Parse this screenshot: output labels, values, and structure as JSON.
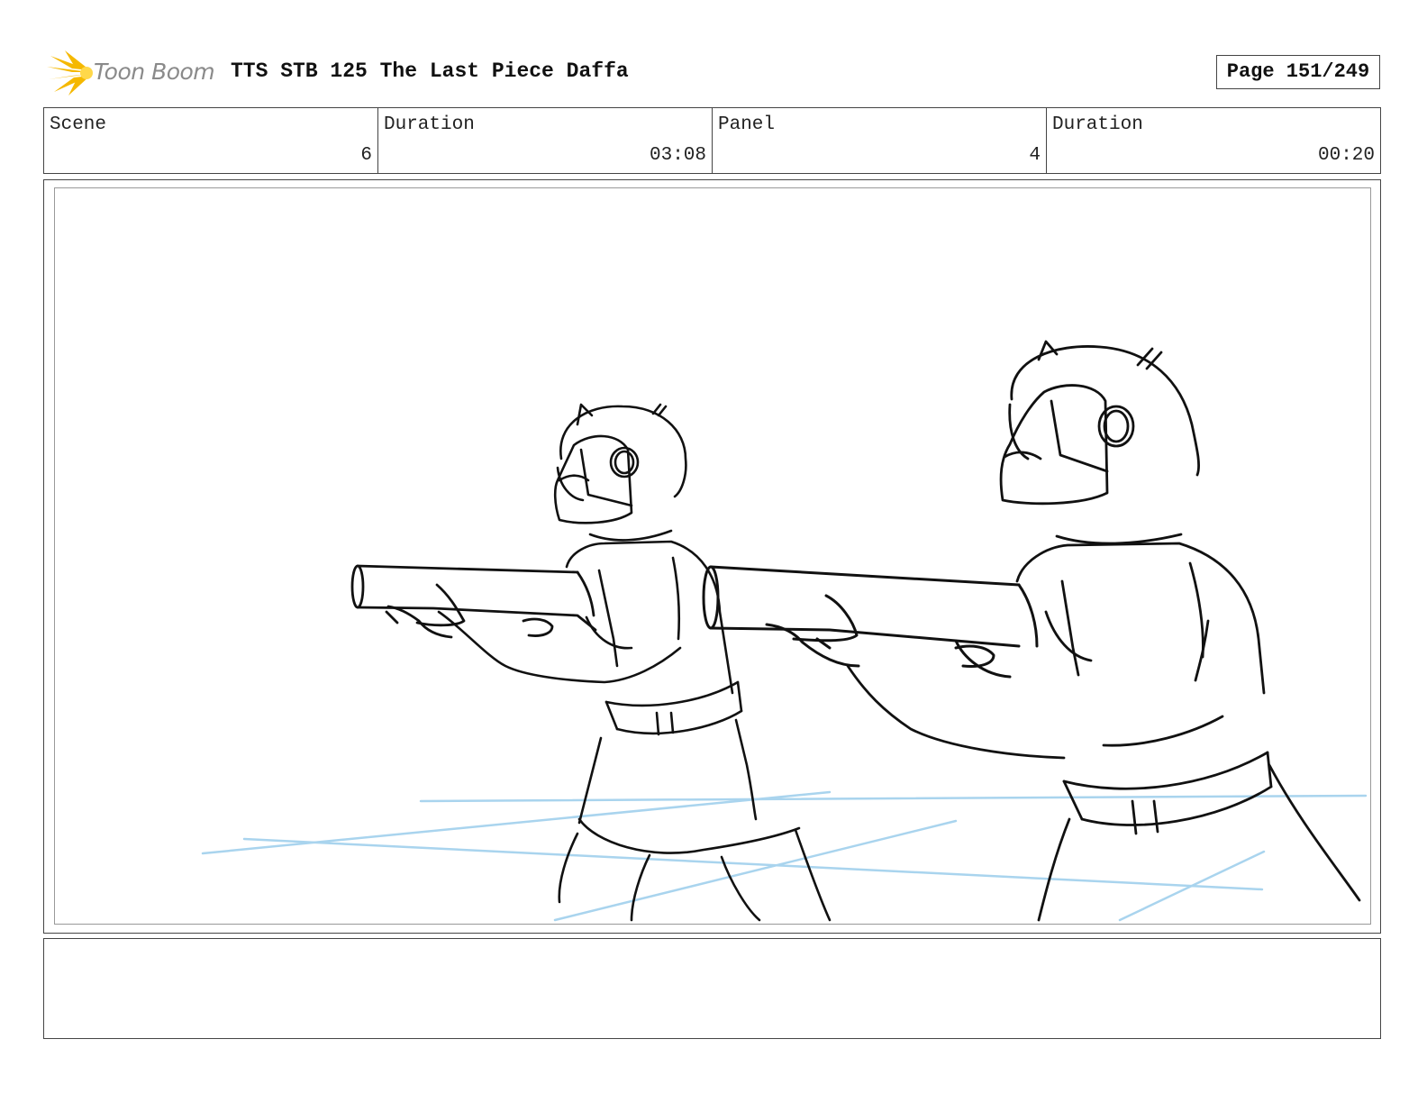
{
  "header": {
    "logo_text": "Toon Boom",
    "title": "TTS STB 125 The Last Piece Daffa",
    "page_label": "Page 151/249"
  },
  "info": [
    {
      "label": "Scene",
      "value": "6"
    },
    {
      "label": "Duration",
      "value": "03:08"
    },
    {
      "label": "Panel",
      "value": "4"
    },
    {
      "label": "Duration",
      "value": "00:20"
    }
  ],
  "colors": {
    "sketch_line": "#111111",
    "guide_line": "#a9d4ee",
    "logo_flare": "#f5b800"
  },
  "notes": {
    "text": ""
  }
}
